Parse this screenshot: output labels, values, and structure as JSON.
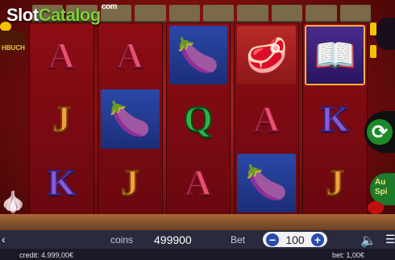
{
  "brand": {
    "slot": "Slot",
    "catalog": "Catalog",
    "com": "com"
  },
  "left_badge": "HBUCH",
  "reels": [
    [
      "A",
      "J",
      "K"
    ],
    [
      "A",
      "eggplant",
      "J"
    ],
    [
      "eggplant",
      "Q",
      "A"
    ],
    [
      "steak",
      "A",
      "eggplant"
    ],
    [
      "book",
      "K",
      "J"
    ]
  ],
  "symbol_icons": {
    "eggplant": "🍆",
    "steak": "🥩",
    "book": "📖"
  },
  "panel": {
    "coins_label": "coins",
    "coins_value": "499900",
    "bet_label": "Bet",
    "bet_value": "100",
    "minus": "−",
    "plus": "+"
  },
  "buttons": {
    "spin": "⟳",
    "auto": "Au\nSpi"
  },
  "status": {
    "credit": "credit: 4.999,00€",
    "bet": "bet: 1,00€"
  }
}
